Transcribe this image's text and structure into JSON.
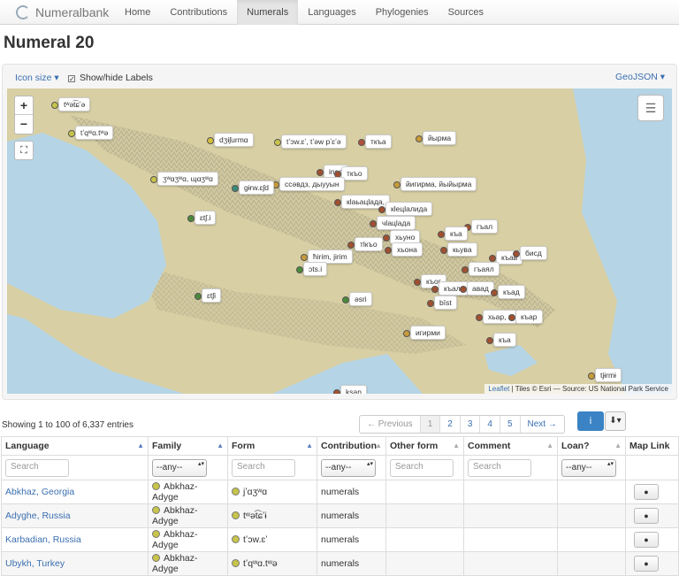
{
  "brand": "Numeralbank",
  "nav": [
    "Home",
    "Contributions",
    "Numerals",
    "Languages",
    "Phylogenies",
    "Sources"
  ],
  "nav_active": 2,
  "title": "Numeral 20",
  "map_toolbar": {
    "icon_size": "Icon size",
    "labels": "Show/hide Labels",
    "labels_checked": "✓",
    "geojson": "GeoJSON"
  },
  "map_controls": {
    "zoom_in": "+",
    "zoom_out": "−"
  },
  "attribution": {
    "leaflet": "Leaflet",
    "tiles": "| Tiles © Esri — Source: US National Park Service"
  },
  "markers": [
    {
      "text": "tʷət͡ɕʼə",
      "color": "#c8c44a"
    },
    {
      "text": "tʼqʷɑ.tʷə",
      "color": "#c8c44a"
    },
    {
      "text": "dʒɨʃurmɑ",
      "color": "#d4c13a"
    },
    {
      "text": "tʼɔw.ɛʼ, tʼəw pʼɛʼə",
      "color": "#c8c44a"
    },
    {
      "text": "ткъа",
      "color": "#b0503a"
    },
    {
      "text": "йырма",
      "color": "#c89b3a"
    },
    {
      "text": "ʒʷɑʒʷɑ, ɰɑʒʷɑ",
      "color": "#c8c44a"
    },
    {
      "text": "inse",
      "color": "#a05030"
    },
    {
      "text": "ткъо",
      "color": "#a05030"
    },
    {
      "text": "ссәвдз, дыууын",
      "color": "#c89b3a"
    },
    {
      "text": "йигирма, йыйырма",
      "color": "#c89b3a"
    },
    {
      "text": "ɡɨrw.ɛʃd",
      "color": "#3a8a7a"
    },
    {
      "text": "ɛtʃ.i",
      "color": "#4a8a3a"
    },
    {
      "text": "кӏаьацӏада,",
      "color": "#a05030"
    },
    {
      "text": "кӏецӏалида",
      "color": "#a05030"
    },
    {
      "text": "чӏацӏада",
      "color": "#a05030"
    },
    {
      "text": "гъал",
      "color": "#a05030"
    },
    {
      "text": "къа",
      "color": "#a05030"
    },
    {
      "text": "хьуно",
      "color": "#a05030"
    },
    {
      "text": "тӏкъо",
      "color": "#a05030"
    },
    {
      "text": "хьона",
      "color": "#a05030"
    },
    {
      "text": "кьува",
      "color": "#a05030"
    },
    {
      "text": "къав",
      "color": "#a05030"
    },
    {
      "text": "бисд",
      "color": "#a05030"
    },
    {
      "text": "ħirim, jirim",
      "color": "#c89b3a"
    },
    {
      "text": "ɔts.i",
      "color": "#4a8a3a"
    },
    {
      "text": "гъаял",
      "color": "#a05030"
    },
    {
      "text": "къог",
      "color": "#a05030"
    },
    {
      "text": "къале",
      "color": "#a05030"
    },
    {
      "text": "авад",
      "color": "#a05030"
    },
    {
      "text": "къад",
      "color": "#a05030"
    },
    {
      "text": "ɛtʃi",
      "color": "#4a8a3a"
    },
    {
      "text": "əsri",
      "color": "#4a8a3a"
    },
    {
      "text": "bīst",
      "color": "#a05030"
    },
    {
      "text": "хьар, х",
      "color": "#a05030"
    },
    {
      "text": "къар",
      "color": "#a05030"
    },
    {
      "text": "игирми",
      "color": "#c89b3a"
    },
    {
      "text": "къа",
      "color": "#a05030"
    },
    {
      "text": "tjɨrmɨ",
      "color": "#c89b3a"
    },
    {
      "text": "ksan",
      "color": "#a05030"
    }
  ],
  "entries_info": "Showing 1 to 100 of 6,337 entries",
  "pagination": {
    "previous": "← Previous",
    "pages": [
      "1",
      "2",
      "3",
      "4",
      "5"
    ],
    "next": "Next →",
    "active": 0
  },
  "buttons": {
    "info": "i",
    "download": "⬇▾"
  },
  "table": {
    "columns": [
      "Language",
      "Family",
      "Form",
      "Contribution",
      "Other form",
      "Comment",
      "Loan?",
      "Map Link"
    ],
    "sorted_col": 0,
    "search_placeholder": "Search",
    "any_option": "--any--",
    "rows": [
      {
        "language": "Abkhaz, Georgia",
        "family": "Abkhaz-Adyge",
        "form": "jʼɑʒʷɑ",
        "contribution": "numerals"
      },
      {
        "language": "Adyghe, Russia",
        "family": "Abkhaz-Adyge",
        "form": "tʷət͡ɕʼɨ",
        "contribution": "numerals"
      },
      {
        "language": "Karbadian, Russia",
        "family": "Abkhaz-Adyge",
        "form": "tʼɔw.ɛʼ",
        "contribution": "numerals"
      },
      {
        "language": "Ubykh, Turkey",
        "family": "Abkhaz-Adyge",
        "form": "tʼqʷɑ.tʷə",
        "contribution": "numerals"
      }
    ],
    "family_color": "#c8c44a"
  }
}
